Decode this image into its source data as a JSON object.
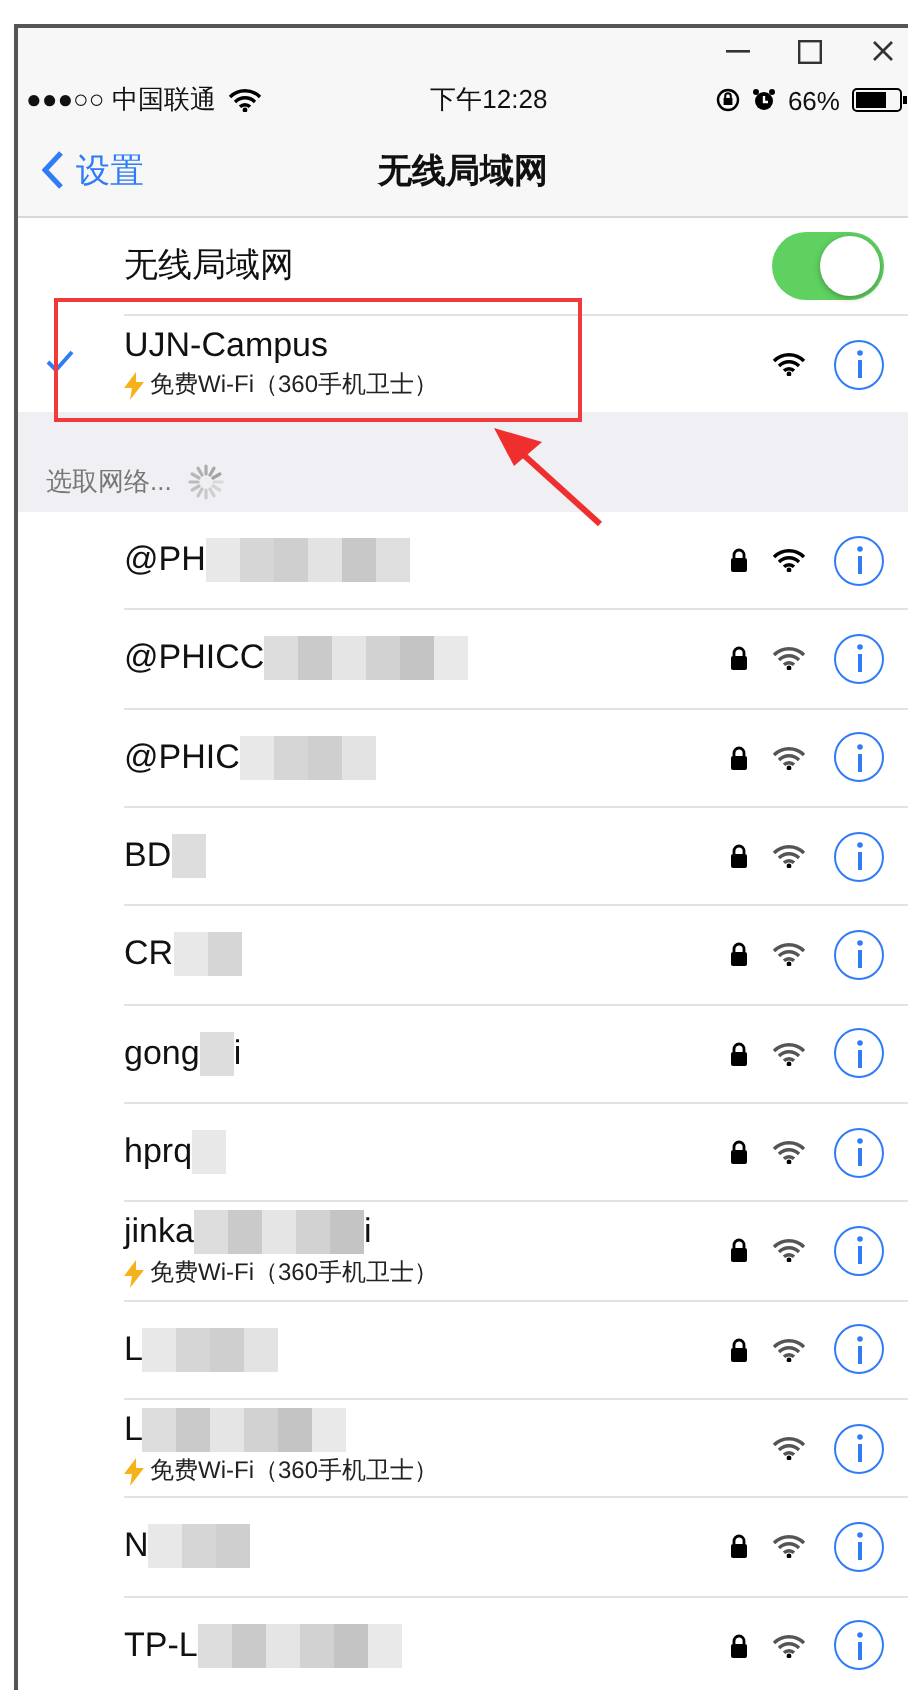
{
  "status_bar": {
    "carrier": "●●●○○ 中国联通",
    "time": "下午12:28",
    "battery": "66%"
  },
  "nav": {
    "back": "设置",
    "title": "无线局域网"
  },
  "wifi_toggle": {
    "label": "无线局域网",
    "on": true
  },
  "current": {
    "name": "UJN-Campus",
    "subtitle": "免费Wi-Fi（360手机卫士）",
    "selected": true
  },
  "section_header": "选取网络...",
  "networks": [
    {
      "name": "@PH",
      "locked": true
    },
    {
      "name": "@PHICC",
      "locked": true
    },
    {
      "name": "@PHIC",
      "locked": true
    },
    {
      "name": "BD",
      "locked": true
    },
    {
      "name": "CR",
      "locked": true
    },
    {
      "name": "gong",
      "tail": "i",
      "locked": true
    },
    {
      "name": "hprq",
      "locked": true
    },
    {
      "name": "jinka",
      "tail": "i",
      "subtitle": "免费Wi-Fi（360手机卫士）",
      "locked": true
    },
    {
      "name": "L",
      "locked": true
    },
    {
      "name": "L",
      "subtitle": "免费Wi-Fi（360手机卫士）",
      "locked": false
    },
    {
      "name": "N",
      "locked": true
    },
    {
      "name": "TP-L",
      "locked": true
    }
  ]
}
